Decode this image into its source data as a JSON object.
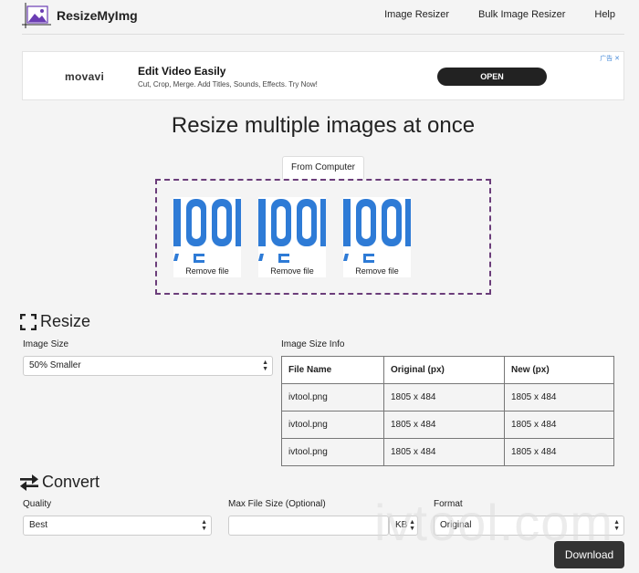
{
  "header": {
    "logo_text": "ResizeMyImg",
    "nav": [
      "Image Resizer",
      "Bulk Image Resizer",
      "Help"
    ]
  },
  "ad": {
    "brand": "movavi",
    "title": "Edit Video Easily",
    "subtitle": "Cut, Crop, Merge. Add Titles, Sounds, Effects. Try Now!",
    "button": "OPEN",
    "corner": "广告 ✕"
  },
  "page_title": "Resize multiple images at once",
  "upload": {
    "tab_label": "From Computer",
    "thumbs": [
      {
        "remove_label": "Remove file"
      },
      {
        "remove_label": "Remove file"
      },
      {
        "remove_label": "Remove file"
      }
    ]
  },
  "resize": {
    "heading": "Resize",
    "image_size_label": "Image Size",
    "image_size_value": "50% Smaller",
    "info_label": "Image Size Info",
    "table": {
      "headers": [
        "File Name",
        "Original (px)",
        "New (px)"
      ],
      "rows": [
        [
          "ivtool.png",
          "1805 x 484",
          "1805 x 484"
        ],
        [
          "ivtool.png",
          "1805 x 484",
          "1805 x 484"
        ],
        [
          "ivtool.png",
          "1805 x 484",
          "1805 x 484"
        ]
      ]
    }
  },
  "convert": {
    "heading": "Convert",
    "quality_label": "Quality",
    "quality_value": "Best",
    "max_size_label": "Max File Size (Optional)",
    "max_size_value": "",
    "unit_value": "KB",
    "format_label": "Format",
    "format_value": "Original"
  },
  "download_label": "Download",
  "watermark": "ivtool.com",
  "colors": {
    "dropzone_border": "#6b3d7a",
    "download_bg": "#333333",
    "thumb_blue": "#2e7bd6"
  }
}
